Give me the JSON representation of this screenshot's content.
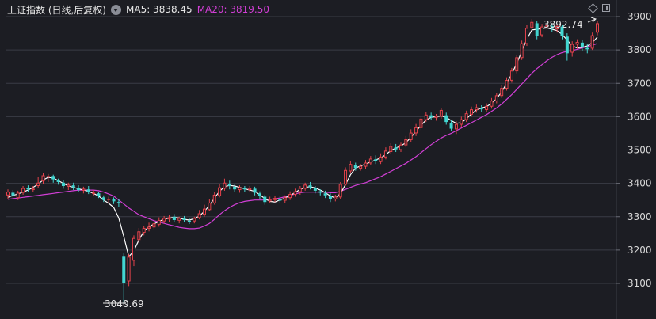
{
  "header": {
    "title": "上证指数 (日线,后复权)",
    "ma5_label": "MA5: 3838.45",
    "ma20_label": "MA20: 3819.50"
  },
  "chart_data": {
    "type": "candlestick",
    "title": "上证指数 (日线,后复权)",
    "y_ticks": [
      3100,
      3200,
      3300,
      3400,
      3500,
      3600,
      3700,
      3800,
      3900
    ],
    "ylim": [
      3020,
      3940
    ],
    "grid": true,
    "colors": {
      "up": "#e4424b",
      "down": "#42d6d1",
      "ma5": "#ffffff",
      "ma20": "#d23fd6",
      "background": "#1c1d23",
      "grid": "#3a3d46"
    },
    "candles": [
      [
        3364,
        3375,
        3382,
        3354
      ],
      [
        3372,
        3364,
        3380,
        3358
      ],
      [
        3356,
        3372,
        3378,
        3350
      ],
      [
        3372,
        3386,
        3392,
        3366
      ],
      [
        3386,
        3382,
        3394,
        3374
      ],
      [
        3380,
        3384,
        3392,
        3374
      ],
      [
        3392,
        3402,
        3420,
        3386
      ],
      [
        3406,
        3424,
        3430,
        3398
      ],
      [
        3418,
        3422,
        3428,
        3404
      ],
      [
        3422,
        3412,
        3426,
        3402
      ],
      [
        3410,
        3404,
        3414,
        3396
      ],
      [
        3402,
        3392,
        3410,
        3384
      ],
      [
        3390,
        3396,
        3402,
        3380
      ],
      [
        3394,
        3388,
        3402,
        3380
      ],
      [
        3386,
        3380,
        3394,
        3374
      ],
      [
        3378,
        3384,
        3390,
        3370
      ],
      [
        3382,
        3374,
        3392,
        3368
      ],
      [
        3372,
        3372,
        3380,
        3362
      ],
      [
        3370,
        3362,
        3374,
        3356
      ],
      [
        3358,
        3350,
        3364,
        3344
      ],
      [
        3350,
        3354,
        3360,
        3342
      ],
      [
        3352,
        3346,
        3358,
        3338
      ],
      [
        3344,
        3340,
        3352,
        3330
      ],
      [
        3180,
        3100,
        3190,
        3040.69
      ],
      [
        3106,
        3180,
        3188,
        3092
      ],
      [
        3168,
        3236,
        3244,
        3152
      ],
      [
        3230,
        3256,
        3266,
        3220
      ],
      [
        3252,
        3266,
        3272,
        3244
      ],
      [
        3264,
        3270,
        3282,
        3256
      ],
      [
        3268,
        3280,
        3288,
        3262
      ],
      [
        3276,
        3290,
        3298,
        3270
      ],
      [
        3286,
        3296,
        3302,
        3280
      ],
      [
        3292,
        3298,
        3306,
        3284
      ],
      [
        3300,
        3290,
        3308,
        3284
      ],
      [
        3288,
        3296,
        3300,
        3280
      ],
      [
        3294,
        3290,
        3302,
        3284
      ],
      [
        3288,
        3284,
        3296,
        3278
      ],
      [
        3286,
        3296,
        3300,
        3280
      ],
      [
        3296,
        3310,
        3320,
        3292
      ],
      [
        3306,
        3324,
        3336,
        3300
      ],
      [
        3320,
        3342,
        3352,
        3316
      ],
      [
        3340,
        3366,
        3374,
        3336
      ],
      [
        3362,
        3388,
        3398,
        3358
      ],
      [
        3384,
        3402,
        3414,
        3378
      ],
      [
        3398,
        3392,
        3408,
        3382
      ],
      [
        3390,
        3382,
        3396,
        3374
      ],
      [
        3380,
        3388,
        3394,
        3372
      ],
      [
        3386,
        3382,
        3392,
        3374
      ],
      [
        3380,
        3386,
        3392,
        3374
      ],
      [
        3384,
        3372,
        3390,
        3364
      ],
      [
        3370,
        3362,
        3376,
        3354
      ],
      [
        3360,
        3344,
        3366,
        3336
      ],
      [
        3346,
        3352,
        3360,
        3340
      ],
      [
        3350,
        3356,
        3362,
        3344
      ],
      [
        3354,
        3348,
        3362,
        3340
      ],
      [
        3348,
        3358,
        3364,
        3342
      ],
      [
        3356,
        3368,
        3376,
        3350
      ],
      [
        3366,
        3376,
        3384,
        3360
      ],
      [
        3374,
        3386,
        3392,
        3366
      ],
      [
        3384,
        3396,
        3402,
        3378
      ],
      [
        3394,
        3388,
        3404,
        3382
      ],
      [
        3386,
        3378,
        3392,
        3370
      ],
      [
        3376,
        3372,
        3382,
        3364
      ],
      [
        3370,
        3364,
        3378,
        3356
      ],
      [
        3362,
        3354,
        3370,
        3344
      ],
      [
        3352,
        3360,
        3366,
        3346
      ],
      [
        3358,
        3398,
        3404,
        3354
      ],
      [
        3396,
        3440,
        3448,
        3392
      ],
      [
        3436,
        3458,
        3468,
        3430
      ],
      [
        3454,
        3446,
        3462,
        3438
      ],
      [
        3444,
        3452,
        3458,
        3438
      ],
      [
        3450,
        3462,
        3470,
        3444
      ],
      [
        3460,
        3474,
        3482,
        3454
      ],
      [
        3472,
        3466,
        3484,
        3458
      ],
      [
        3464,
        3480,
        3490,
        3458
      ],
      [
        3478,
        3498,
        3508,
        3472
      ],
      [
        3494,
        3512,
        3520,
        3488
      ],
      [
        3508,
        3502,
        3518,
        3494
      ],
      [
        3500,
        3516,
        3522,
        3494
      ],
      [
        3514,
        3532,
        3542,
        3508
      ],
      [
        3530,
        3552,
        3562,
        3524
      ],
      [
        3550,
        3568,
        3578,
        3542
      ],
      [
        3566,
        3594,
        3602,
        3560
      ],
      [
        3590,
        3606,
        3614,
        3584
      ],
      [
        3604,
        3598,
        3612,
        3590
      ],
      [
        3596,
        3602,
        3608,
        3588
      ],
      [
        3600,
        3620,
        3626,
        3594
      ],
      [
        3604,
        3584,
        3612,
        3576
      ],
      [
        3582,
        3564,
        3590,
        3556
      ],
      [
        3562,
        3578,
        3586,
        3548
      ],
      [
        3576,
        3592,
        3600,
        3570
      ],
      [
        3590,
        3610,
        3618,
        3584
      ],
      [
        3606,
        3622,
        3630,
        3600
      ],
      [
        3620,
        3628,
        3636,
        3612
      ],
      [
        3626,
        3622,
        3634,
        3614
      ],
      [
        3620,
        3632,
        3640,
        3614
      ],
      [
        3630,
        3648,
        3656,
        3624
      ],
      [
        3646,
        3664,
        3672,
        3640
      ],
      [
        3662,
        3686,
        3694,
        3656
      ],
      [
        3684,
        3710,
        3718,
        3678
      ],
      [
        3708,
        3738,
        3746,
        3702
      ],
      [
        3736,
        3778,
        3786,
        3730
      ],
      [
        3776,
        3820,
        3828,
        3770
      ],
      [
        3818,
        3866,
        3874,
        3812
      ],
      [
        3866,
        3884,
        3892.74,
        3858
      ],
      [
        3880,
        3842,
        3888,
        3832
      ],
      [
        3844,
        3870,
        3878,
        3838
      ],
      [
        3868,
        3874,
        3884,
        3860
      ],
      [
        3872,
        3864,
        3880,
        3854
      ],
      [
        3862,
        3872,
        3878,
        3852
      ],
      [
        3870,
        3842,
        3876,
        3832
      ],
      [
        3840,
        3790,
        3850,
        3768
      ],
      [
        3792,
        3818,
        3826,
        3780
      ],
      [
        3816,
        3824,
        3832,
        3804
      ],
      [
        3822,
        3808,
        3830,
        3798
      ],
      [
        3806,
        3802,
        3818,
        3790
      ],
      [
        3804,
        3844,
        3852,
        3800
      ],
      [
        3852,
        3880,
        3888,
        3844
      ]
    ],
    "ma5": [
      3358,
      3364,
      3368,
      3374,
      3380,
      3388,
      3398,
      3410,
      3418,
      3416,
      3408,
      3400,
      3392,
      3388,
      3384,
      3380,
      3376,
      3370,
      3362,
      3350,
      3340,
      3328,
      3296,
      3240,
      3180,
      3198,
      3230,
      3256,
      3270,
      3278,
      3286,
      3292,
      3296,
      3298,
      3296,
      3292,
      3290,
      3294,
      3302,
      3316,
      3334,
      3356,
      3376,
      3390,
      3394,
      3392,
      3388,
      3384,
      3380,
      3376,
      3366,
      3354,
      3346,
      3344,
      3350,
      3356,
      3364,
      3372,
      3382,
      3388,
      3390,
      3386,
      3380,
      3372,
      3362,
      3356,
      3370,
      3396,
      3426,
      3446,
      3452,
      3458,
      3464,
      3470,
      3476,
      3486,
      3498,
      3506,
      3512,
      3522,
      3538,
      3556,
      3574,
      3590,
      3598,
      3600,
      3602,
      3598,
      3588,
      3580,
      3582,
      3594,
      3608,
      3620,
      3626,
      3630,
      3640,
      3654,
      3674,
      3700,
      3728,
      3760,
      3796,
      3832,
      3860,
      3862,
      3864,
      3866,
      3862,
      3858,
      3846,
      3830,
      3812,
      3806,
      3808,
      3812,
      3822,
      3838.45
    ],
    "ma20": [
      3352,
      3354,
      3356,
      3358,
      3360,
      3362,
      3364,
      3366,
      3368,
      3370,
      3372,
      3374,
      3376,
      3378,
      3380,
      3380,
      3380,
      3380,
      3378,
      3374,
      3368,
      3362,
      3350,
      3338,
      3326,
      3316,
      3306,
      3300,
      3294,
      3288,
      3284,
      3280,
      3276,
      3272,
      3268,
      3266,
      3264,
      3264,
      3266,
      3272,
      3280,
      3292,
      3306,
      3318,
      3328,
      3336,
      3342,
      3346,
      3348,
      3350,
      3350,
      3350,
      3352,
      3354,
      3356,
      3360,
      3364,
      3368,
      3372,
      3374,
      3374,
      3374,
      3374,
      3374,
      3372,
      3372,
      3376,
      3382,
      3388,
      3394,
      3398,
      3402,
      3408,
      3414,
      3420,
      3428,
      3436,
      3444,
      3452,
      3460,
      3470,
      3480,
      3492,
      3504,
      3516,
      3526,
      3536,
      3544,
      3550,
      3558,
      3566,
      3574,
      3582,
      3590,
      3598,
      3606,
      3616,
      3626,
      3638,
      3652,
      3666,
      3682,
      3698,
      3714,
      3730,
      3744,
      3756,
      3768,
      3778,
      3786,
      3792,
      3796,
      3798,
      3802,
      3806,
      3810,
      3814,
      3819.5
    ],
    "annotations": {
      "high": "3892.74",
      "low": "3040.69"
    }
  }
}
